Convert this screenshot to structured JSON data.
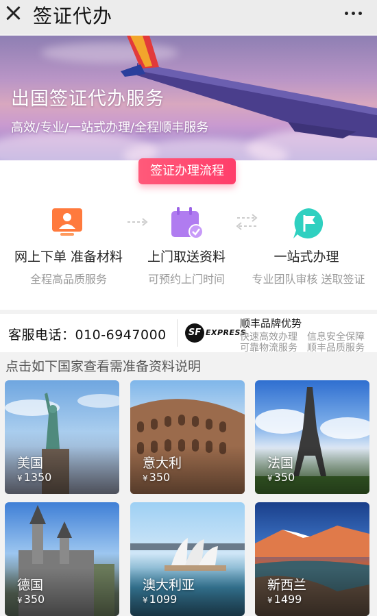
{
  "nav": {
    "title": "签证代办",
    "close_icon": "close-icon",
    "more_icon": "more-dots-icon"
  },
  "banner": {
    "title": "出国签证代办服务",
    "subtitle": "高效/专业/一站式办理/全程顺丰服务"
  },
  "process": {
    "button_label": "签证办理流程",
    "steps": [
      {
        "title": "网上下单 准备材料",
        "desc": "全程高品质服务",
        "icon": "monitor-user-icon",
        "color": "#ff7a3d"
      },
      {
        "title": "上门取送资料",
        "desc": "可预约上门时间",
        "icon": "calendar-check-icon",
        "color": "#b07cf0"
      },
      {
        "title": "一站式办理",
        "desc": "专业团队审核 送取签证",
        "icon": "flag-chat-icon",
        "color": "#2fd0c0"
      }
    ]
  },
  "service": {
    "phone": "客服电话：010-6947000",
    "sf_mark": "SF",
    "sf_express": "EXPRESS",
    "sf_brand": "顺丰品牌优势",
    "features": [
      "快速高效办理",
      "信息安全保障",
      "可靠物流服务",
      "顺丰品质服务"
    ]
  },
  "section_heading": "点击如下国家查看需准备资料说明",
  "countries": [
    {
      "name": "美国",
      "currency": "¥",
      "price": "1350"
    },
    {
      "name": "意大利",
      "currency": "¥",
      "price": "350"
    },
    {
      "name": "法国",
      "currency": "¥",
      "price": "350"
    },
    {
      "name": "德国",
      "currency": "¥",
      "price": "350"
    },
    {
      "name": "澳大利亚",
      "currency": "¥",
      "price": "1099"
    },
    {
      "name": "新西兰",
      "currency": "¥",
      "price": "1499"
    }
  ],
  "colors": {
    "accent": "#ff4a70",
    "muted_text": "#9a9a9a"
  }
}
